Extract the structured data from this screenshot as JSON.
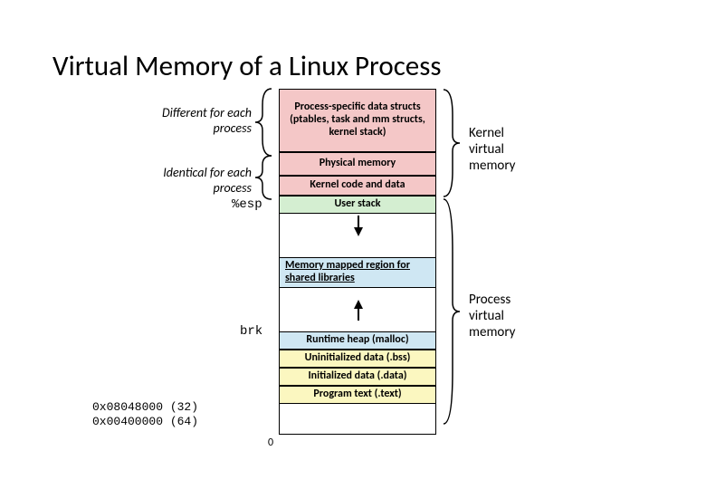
{
  "title": "Virtual Memory of a Linux Process",
  "left_labels": {
    "different": "Different for each process",
    "identical": "Identical  for each process",
    "esp": "%esp",
    "brk": "brk",
    "addr32": "0x08048000 (32)",
    "addr64": "0x00400000 (64)"
  },
  "right_labels": {
    "kvm": "Kernel virtual memory",
    "pvm": "Process virtual memory"
  },
  "segments": {
    "pspec": "Process-specific data structs  (ptables, task and mm structs, kernel stack)",
    "phys": "Physical memory",
    "kcode": "Kernel code and data",
    "ustack": "User stack",
    "mmap": "Memory mapped region for shared libraries",
    "heap": "Runtime heap (malloc)",
    "bss": "Uninitialized data (.bss)",
    "data": "Initialized data (.data)",
    "text": "Program text (.text)"
  },
  "zero": "0"
}
